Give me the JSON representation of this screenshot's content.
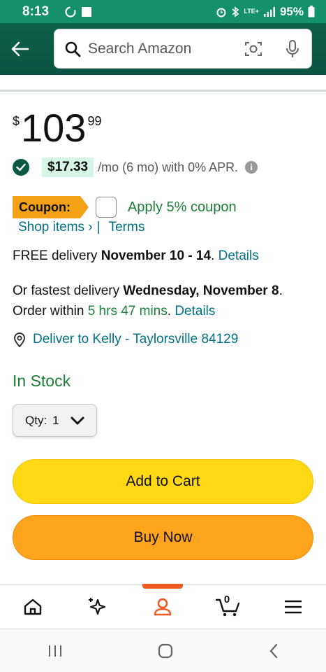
{
  "status_bar": {
    "time": "8:13",
    "battery": "95%",
    "network": "LTE+"
  },
  "search": {
    "placeholder": "Search Amazon"
  },
  "price": {
    "symbol": "$",
    "whole": "103",
    "fraction": "99"
  },
  "financing": {
    "amount": "$17.33",
    "text": "/mo (6 mo) with 0% APR."
  },
  "coupon": {
    "badge": "Coupon:",
    "apply_label": "Apply 5% coupon",
    "shop_items": "Shop items ›",
    "separator": "|",
    "terms": "Terms"
  },
  "delivery": {
    "prefix": "FREE delivery ",
    "dates": "November 10 - 14",
    "suffix": ". ",
    "details": "Details"
  },
  "fastest": {
    "prefix": "Or fastest delivery ",
    "date": "Wednesday, November 8",
    "mid": ". Order within ",
    "countdown": "5 hrs 47 mins",
    "suffix": ". ",
    "details": "Details"
  },
  "location": {
    "text": "Deliver to Kelly - Taylorsville 84129"
  },
  "stock": {
    "text": "In Stock"
  },
  "quantity": {
    "label": "Qty:",
    "value": "1"
  },
  "buttons": {
    "add_to_cart": "Add to Cart",
    "buy_now": "Buy Now"
  },
  "bottom_nav": {
    "cart_count": "0",
    "items": [
      "home-icon",
      "ai-sparkle-icon",
      "account-icon",
      "cart-icon",
      "menu-icon"
    ]
  },
  "colors": {
    "header": "#0b5945",
    "status_bar": "#14906a",
    "link": "#007185",
    "in_stock": "#1a7f37",
    "add_to_cart": "#ffd814",
    "buy_now": "#ffa41c",
    "coupon_badge": "#f3a117",
    "active_nav": "#f05a24"
  }
}
